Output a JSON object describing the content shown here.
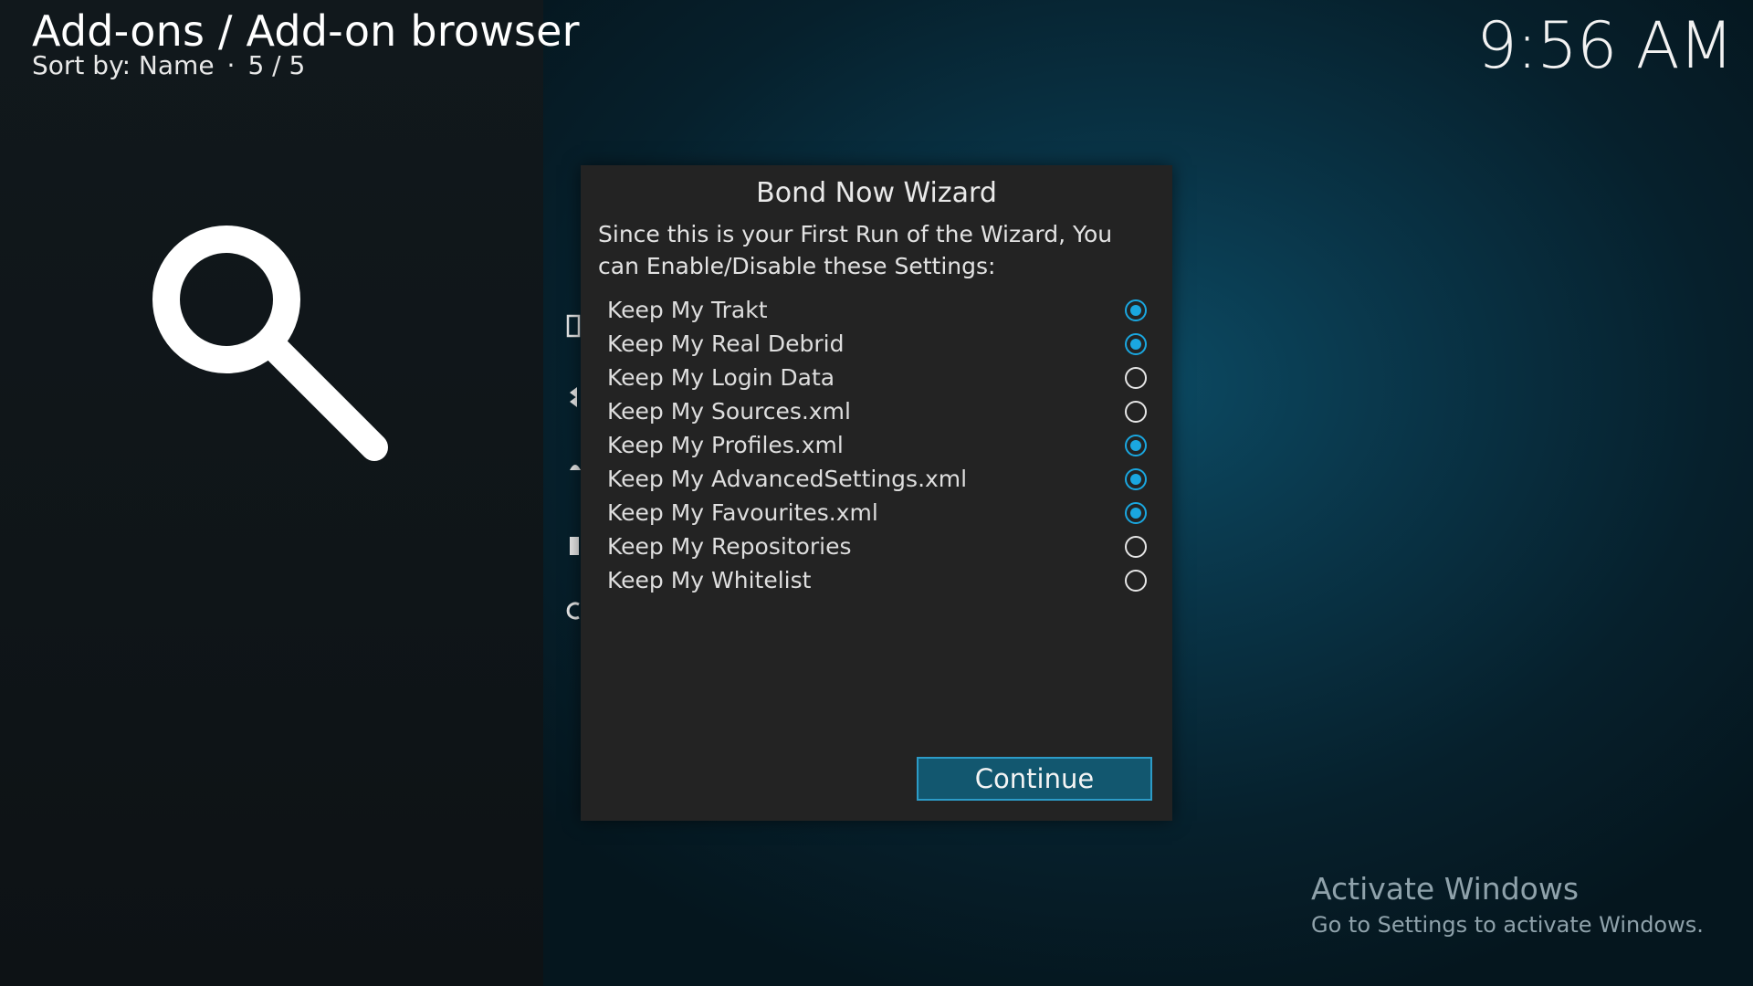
{
  "header": {
    "title": "Add-ons / Add-on browser",
    "sort_label": "Sort by: Name",
    "separator": "·",
    "count": "5 / 5"
  },
  "clock": "9:56 AM",
  "left_panel": {
    "icon": "search-icon"
  },
  "dialog": {
    "title": "Bond Now Wizard",
    "message": "Since this is your First Run of the Wizard, You can Enable/Disable these Settings:",
    "options": [
      {
        "label": "Keep My Trakt",
        "selected": true
      },
      {
        "label": "Keep My Real Debrid",
        "selected": true
      },
      {
        "label": "Keep My Login Data",
        "selected": false
      },
      {
        "label": "Keep My Sources.xml",
        "selected": false
      },
      {
        "label": "Keep My Profiles.xml",
        "selected": true
      },
      {
        "label": "Keep My AdvancedSettings.xml",
        "selected": true
      },
      {
        "label": "Keep My Favourites.xml",
        "selected": true
      },
      {
        "label": "Keep My Repositories",
        "selected": false
      },
      {
        "label": "Keep My Whitelist",
        "selected": false
      }
    ],
    "continue_label": "Continue"
  },
  "watermark": {
    "title": "Activate Windows",
    "subtitle": "Go to Settings to activate Windows."
  },
  "colors": {
    "accent": "#1aa7e0",
    "button_bg": "#12576f",
    "dialog_bg": "#232323",
    "panel_bg": "#11181c"
  }
}
